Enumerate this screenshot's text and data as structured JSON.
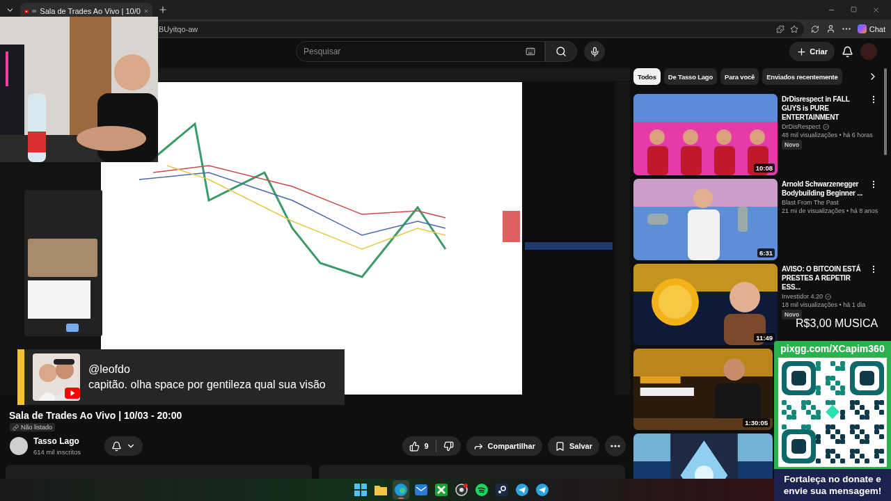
{
  "browser": {
    "tabs": [
      {
        "title": "Sala de Trades Ao Vivo | 10/0",
        "audio": true,
        "selected": true
      }
    ],
    "address": "BUyitqo-aw",
    "chat_label": "Chat"
  },
  "masthead": {
    "search_placeholder": "Pesquisar",
    "create_label": "Criar"
  },
  "video_info": {
    "title": "Sala de Trades Ao Vivo | 10/03 - 20:00",
    "visibility": "Não listado",
    "channel": "Tasso Lago",
    "subscribers": "614 mil inscritos",
    "likes": "9",
    "share_label": "Compartilhar",
    "save_label": "Salvar"
  },
  "chips": [
    {
      "label": "Todos",
      "selected": true
    },
    {
      "label": "De Tasso Lago",
      "selected": false
    },
    {
      "label": "Para você",
      "selected": false
    },
    {
      "label": "Enviados recentemente",
      "selected": false
    }
  ],
  "related": [
    {
      "kind": "video",
      "title": "DrDisrespect in FALL GUYS is PURE ENTERTAINMENT",
      "channel": "DrDisRespect",
      "verified": true,
      "stats": "48 mil visualizações • há 6 horas",
      "badge": "Novo",
      "duration": "10:08"
    },
    {
      "kind": "video",
      "title": "Arnold Schwarzenegger Bodybuilding Beginner ...",
      "channel": "Blast From The Past",
      "verified": false,
      "stats": "21 mi de visualizações • há 8 anos",
      "duration": "6:31"
    },
    {
      "kind": "video",
      "title": "AVISO: O BITCOIN ESTÁ PRESTES A REPETIR ESS...",
      "channel": "Investidor 4.20",
      "verified": true,
      "stats": "18 mil visualizações • há 1 dia",
      "badge": "Novo",
      "duration": "11:49"
    },
    {
      "kind": "picture",
      "duration": "1:30:05"
    },
    {
      "kind": "picture"
    }
  ],
  "overlays": {
    "chat": {
      "author": "@leofdo",
      "message": "capitão. olha space por gentileza qual sua visão"
    },
    "music_price": "R$3,00 MUSICA",
    "donate": {
      "url": "pixgg.com/XCapim360",
      "message": "Fortaleça no donate e envie sua mensagem!"
    }
  },
  "taskbar": [
    {
      "kind": "start",
      "selected": false
    },
    {
      "kind": "explorer",
      "selected": false
    },
    {
      "kind": "edge",
      "selected": true
    },
    {
      "kind": "mail",
      "selected": false
    },
    {
      "kind": "xbox",
      "selected": false
    },
    {
      "kind": "obs",
      "selected": false
    },
    {
      "kind": "spotify",
      "selected": false
    },
    {
      "kind": "steam",
      "selected": false
    },
    {
      "kind": "telegram",
      "selected": false
    },
    {
      "kind": "telegram",
      "selected": false
    }
  ]
}
